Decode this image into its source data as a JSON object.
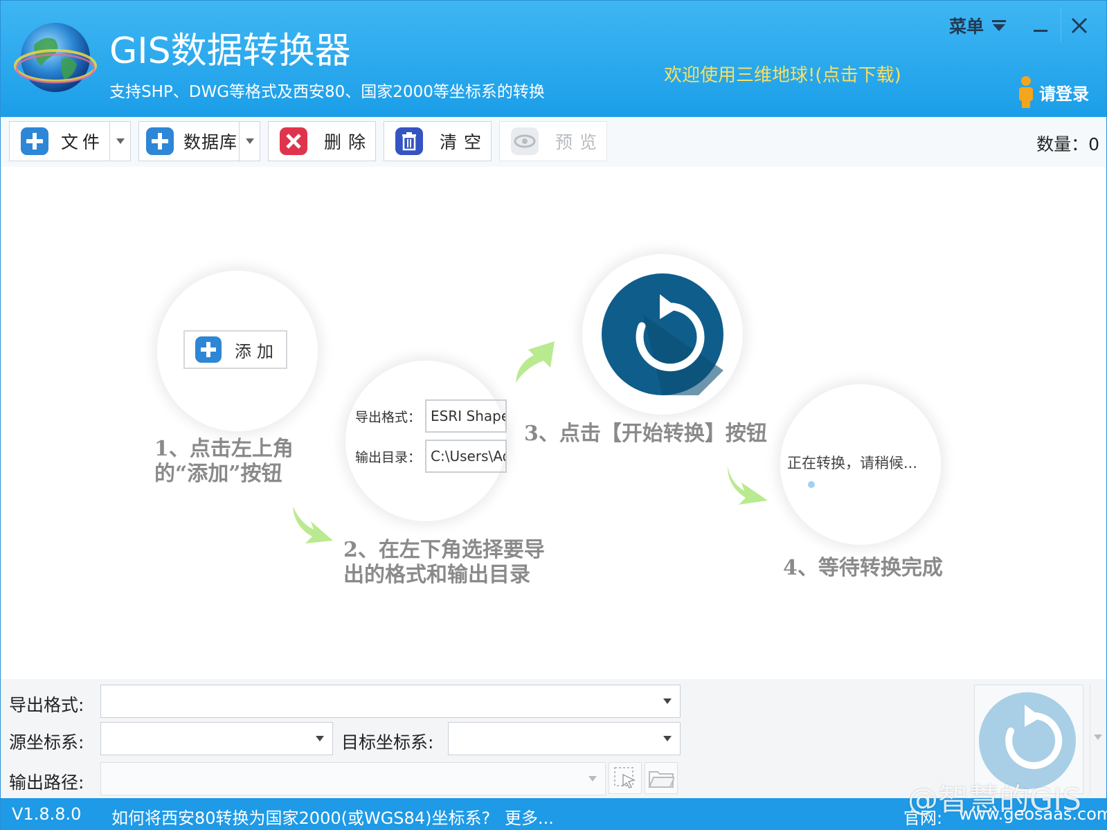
{
  "header": {
    "title": "GIS数据转换器",
    "subtitle": "支持SHP、DWG等格式及西安80、国家2000等坐标系的转换",
    "welcome": "欢迎使用三维地球!(点击下载)",
    "menu_label": "菜单",
    "login_label": "请登录"
  },
  "toolbar": {
    "file_label": "文件",
    "database_label": "数据库",
    "delete_label": "删除",
    "clear_label": "清空",
    "preview_label": "预览",
    "count_label": "数量：0"
  },
  "guide": {
    "add_button_label": "添加",
    "step1_line1": "1、点击左上角",
    "step1_line2": "的“添加”按钮",
    "demo_format_label": "导出格式：",
    "demo_format_value": "ESRI Shapefile",
    "demo_dir_label": "输出目录：",
    "demo_dir_value": "C:\\Users\\Adm",
    "step2_line1": "2、在左下角选择要导",
    "step2_line2": "出的格式和输出目录",
    "step3_text": "3、点击【开始转换】按钮",
    "converting_text": "正在转换，请稍候...",
    "step4_text": "4、等待转换完成"
  },
  "form": {
    "export_format_label": "导出格式:",
    "export_format_value": "",
    "source_crs_label": "源坐标系:",
    "source_crs_value": "",
    "target_crs_label": "目标坐标系:",
    "target_crs_value": "",
    "output_path_label": "输出路径:",
    "output_path_value": ""
  },
  "status": {
    "version": "V1.8.8.0",
    "help_link": "如何将西安80转换为国家2000(或WGS84)坐标系?",
    "more_link": "更多...",
    "website_label": "官网:",
    "website": "www.geosaas.com"
  },
  "watermark": "@智慧的GIS",
  "colors": {
    "header": "#1b9ee8",
    "status_bar": "#1e9ae6",
    "welcome_text": "#f8e063",
    "step_text": "#8a8a8a",
    "arrow_green": "#b9ea8f",
    "start_circle": "#0f5d8a"
  }
}
